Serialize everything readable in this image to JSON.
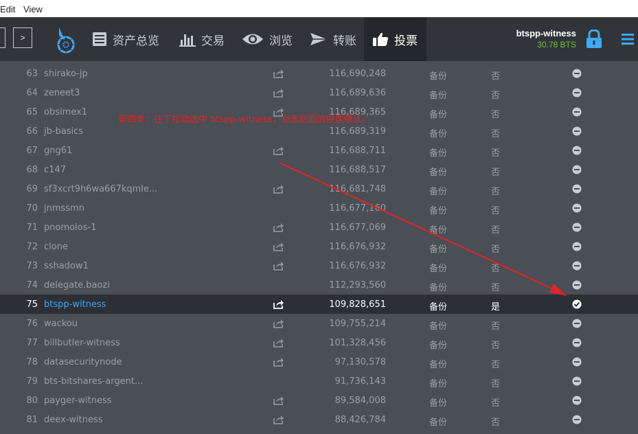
{
  "menu": {
    "edit": "Edit",
    "view": "View"
  },
  "nav_buttons": {
    "back": "",
    "forward": ">"
  },
  "nav": [
    {
      "label": "资产总览",
      "icon": "dashboard-icon"
    },
    {
      "label": "交易",
      "icon": "chart-bars-icon"
    },
    {
      "label": "浏览",
      "icon": "eye-icon"
    },
    {
      "label": "转账",
      "icon": "paper-plane-icon"
    },
    {
      "label": "投票",
      "icon": "thumbs-up-icon"
    }
  ],
  "account": {
    "name": "btspp-witness",
    "balance": "30.78 BTS"
  },
  "annotation": "第四步：往下拉动选中 btspp-witness，点击后面的投票确认。",
  "rows": [
    {
      "rank": "63",
      "name": "shirako-jp",
      "link": true,
      "votes": "116,690,248",
      "status": "备份",
      "voted": "否",
      "checked": false
    },
    {
      "rank": "64",
      "name": "zeneet3",
      "link": true,
      "votes": "116,689,636",
      "status": "备份",
      "voted": "否",
      "checked": false
    },
    {
      "rank": "65",
      "name": "obsimex1",
      "link": true,
      "votes": "116,689,365",
      "status": "备份",
      "voted": "否",
      "checked": false
    },
    {
      "rank": "66",
      "name": "jb-basics",
      "link": false,
      "votes": "116,689,319",
      "status": "备份",
      "voted": "否",
      "checked": false
    },
    {
      "rank": "67",
      "name": "gng61",
      "link": true,
      "votes": "116,688,711",
      "status": "备份",
      "voted": "否",
      "checked": false
    },
    {
      "rank": "68",
      "name": "c147",
      "link": false,
      "votes": "116,688,517",
      "status": "备份",
      "voted": "否",
      "checked": false
    },
    {
      "rank": "69",
      "name": "sf3xcrt9h6wa667kqmle...",
      "link": true,
      "votes": "116,681,748",
      "status": "备份",
      "voted": "否",
      "checked": false
    },
    {
      "rank": "70",
      "name": "jnmssmn",
      "link": false,
      "votes": "116,677,160",
      "status": "备份",
      "voted": "否",
      "checked": false
    },
    {
      "rank": "71",
      "name": "pnomolos-1",
      "link": true,
      "votes": "116,677,069",
      "status": "备份",
      "voted": "否",
      "checked": false
    },
    {
      "rank": "72",
      "name": "clone",
      "link": true,
      "votes": "116,676,932",
      "status": "备份",
      "voted": "否",
      "checked": false
    },
    {
      "rank": "73",
      "name": "sshadow1",
      "link": true,
      "votes": "116,676,932",
      "status": "备份",
      "voted": "否",
      "checked": false
    },
    {
      "rank": "74",
      "name": "delegate.baozi",
      "link": false,
      "votes": "112,293,560",
      "status": "备份",
      "voted": "否",
      "checked": false
    },
    {
      "rank": "75",
      "name": "btspp-witness",
      "link": true,
      "votes": "109,828,651",
      "status": "备份",
      "voted": "是",
      "checked": true,
      "selected": true
    },
    {
      "rank": "76",
      "name": "wackou",
      "link": true,
      "votes": "109,755,214",
      "status": "备份",
      "voted": "否",
      "checked": false
    },
    {
      "rank": "77",
      "name": "billbutler-witness",
      "link": true,
      "votes": "101,328,456",
      "status": "备份",
      "voted": "否",
      "checked": false
    },
    {
      "rank": "78",
      "name": "datasecuritynode",
      "link": true,
      "votes": "97,130,578",
      "status": "备份",
      "voted": "否",
      "checked": false
    },
    {
      "rank": "79",
      "name": "bts-bitshares-argent...",
      "link": false,
      "votes": "91,736,143",
      "status": "备份",
      "voted": "否",
      "checked": false
    },
    {
      "rank": "80",
      "name": "payger-witness",
      "link": true,
      "votes": "89,584,008",
      "status": "备份",
      "voted": "否",
      "checked": false
    },
    {
      "rank": "81",
      "name": "deex-witness",
      "link": true,
      "votes": "88,426,784",
      "status": "备份",
      "voted": "否",
      "checked": false
    }
  ]
}
